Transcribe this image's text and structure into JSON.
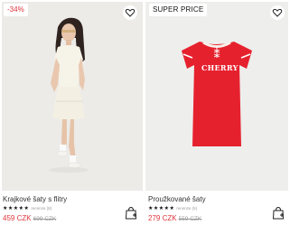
{
  "products": [
    {
      "badge": "-34%",
      "title": "Krajkové šaty s flitry",
      "stars": "★★★★★",
      "reviews": "recenze (8)",
      "price": "459 CZK",
      "old_price": "699 CZK",
      "icons": {
        "favorite": "heart-icon",
        "cart": "shopping-bag-plus-icon"
      },
      "colors": {
        "badge_text": "#e0343a",
        "dress": "#f4f1e6"
      }
    },
    {
      "badge": "SUPER PRICE",
      "title": "Proužkované šaty",
      "stars": "★★★★★",
      "reviews": "recenze (5)",
      "price": "279 CZK",
      "old_price": "559 CZK",
      "print": "CHERRY",
      "icons": {
        "favorite": "heart-icon",
        "cart": "shopping-bag-plus-icon"
      },
      "colors": {
        "dress": "#e6212e",
        "price": "#e0343a"
      }
    }
  ]
}
